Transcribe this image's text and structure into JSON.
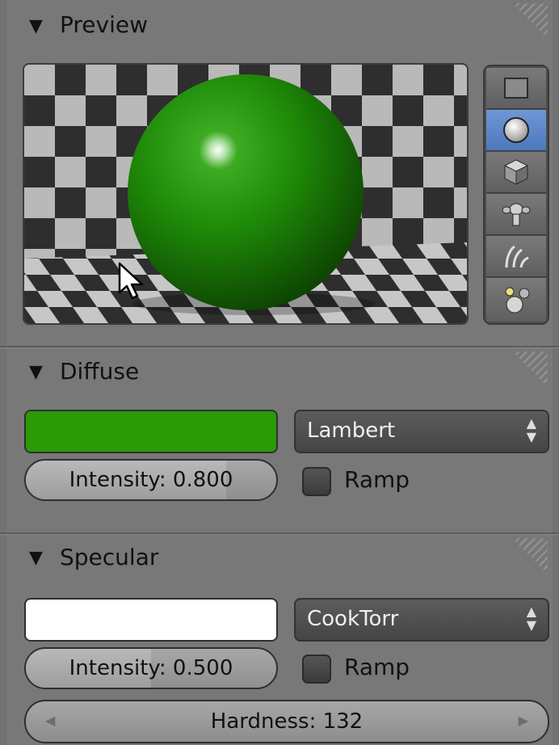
{
  "preview": {
    "title": "Preview",
    "sphere_color": "#1f8a08",
    "tools": [
      {
        "icon": "flat-plane-icon",
        "active": false
      },
      {
        "icon": "sphere-icon",
        "active": true
      },
      {
        "icon": "cube-icon",
        "active": false
      },
      {
        "icon": "monkey-icon",
        "active": false
      },
      {
        "icon": "hair-strands-icon",
        "active": false
      },
      {
        "icon": "sphere-with-lamp-icon",
        "active": false
      }
    ]
  },
  "diffuse": {
    "title": "Diffuse",
    "color": "#2a9a07",
    "shader": "Lambert",
    "intensity_label": "Intensity: 0.800",
    "intensity_value": 0.8,
    "ramp_label": "Ramp",
    "ramp_checked": false
  },
  "specular": {
    "title": "Specular",
    "color": "#ffffff",
    "shader": "CookTorr",
    "intensity_label": "Intensity: 0.500",
    "intensity_value": 0.5,
    "ramp_label": "Ramp",
    "ramp_checked": false,
    "hardness_label": "Hardness: 132"
  },
  "icons": {
    "collapse": "triangle-down-icon",
    "dropdown": "up-down-arrows-icon",
    "cursor": "mouse-pointer-icon"
  }
}
